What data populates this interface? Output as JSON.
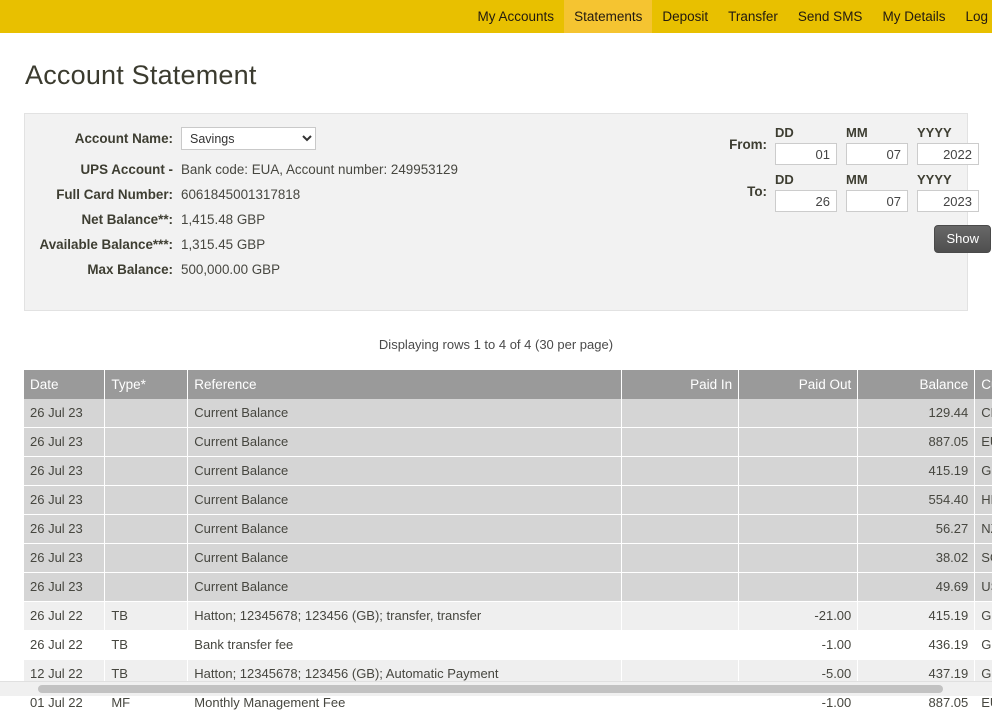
{
  "nav": {
    "items": [
      {
        "label": "My Accounts",
        "active": false
      },
      {
        "label": "Statements",
        "active": true
      },
      {
        "label": "Deposit",
        "active": false
      },
      {
        "label": "Transfer",
        "active": false
      },
      {
        "label": "Send SMS",
        "active": false
      },
      {
        "label": "My Details",
        "active": false
      },
      {
        "label": "Log",
        "active": false
      }
    ],
    "background_color": "#e8c000",
    "active_color": "#f5c431"
  },
  "page": {
    "title": "Account Statement"
  },
  "account_panel": {
    "account_name_label": "Account Name:",
    "account_name_value": "Savings",
    "account_name_options": [
      "Savings"
    ],
    "ups_account_label": "UPS Account -",
    "ups_account_value": "Bank code: EUA, Account number: 249953129",
    "full_card_label": "Full Card Number:",
    "full_card_value": "6061845001317818",
    "net_balance_label": "Net Balance**:",
    "net_balance_value": "1,415.48  GBP",
    "available_balance_label": "Available Balance***:",
    "available_balance_value": "1,315.45 GBP",
    "max_balance_label": "Max Balance:",
    "max_balance_value": "500,000.00  GBP"
  },
  "date_range": {
    "from_label": "From:",
    "to_label": "To:",
    "dd_label": "DD",
    "mm_label": "MM",
    "yyyy_label": "YYYY",
    "from_dd": "01",
    "from_mm": "07",
    "from_yyyy": "2022",
    "to_dd": "26",
    "to_mm": "07",
    "to_yyyy": "2023",
    "show_button": "Show"
  },
  "results": {
    "rows_info": "Displaying rows 1 to 4 of 4 (30 per page)",
    "columns": [
      "Date",
      "Type*",
      "Reference",
      "Paid In",
      "Paid Out",
      "Balance",
      "Currency"
    ],
    "rows": [
      {
        "date": "26 Jul 23",
        "type": "",
        "reference": "Current Balance",
        "paid_in": "",
        "paid_out": "",
        "balance": "129.44",
        "currency": "CHF",
        "style": "bal-row"
      },
      {
        "date": "26 Jul 23",
        "type": "",
        "reference": "Current Balance",
        "paid_in": "",
        "paid_out": "",
        "balance": "887.05",
        "currency": "EUR",
        "style": "bal-row"
      },
      {
        "date": "26 Jul 23",
        "type": "",
        "reference": "Current Balance",
        "paid_in": "",
        "paid_out": "",
        "balance": "415.19",
        "currency": "GBP",
        "style": "bal-row"
      },
      {
        "date": "26 Jul 23",
        "type": "",
        "reference": "Current Balance",
        "paid_in": "",
        "paid_out": "",
        "balance": "554.40",
        "currency": "HKD",
        "style": "bal-row"
      },
      {
        "date": "26 Jul 23",
        "type": "",
        "reference": "Current Balance",
        "paid_in": "",
        "paid_out": "",
        "balance": "56.27",
        "currency": "NZD",
        "style": "bal-row"
      },
      {
        "date": "26 Jul 23",
        "type": "",
        "reference": "Current Balance",
        "paid_in": "",
        "paid_out": "",
        "balance": "38.02",
        "currency": "SGD",
        "style": "bal-row"
      },
      {
        "date": "26 Jul 23",
        "type": "",
        "reference": "Current Balance",
        "paid_in": "",
        "paid_out": "",
        "balance": "49.69",
        "currency": "USD",
        "style": "bal-row"
      },
      {
        "date": "26 Jul 22",
        "type": "TB",
        "reference": "Hatton; 12345678; 123456 (GB); transfer, transfer",
        "paid_in": "",
        "paid_out": "-21.00",
        "balance": "415.19",
        "currency": "GBP",
        "style": "txn-odd"
      },
      {
        "date": "26 Jul 22",
        "type": "TB",
        "reference": "Bank transfer fee",
        "paid_in": "",
        "paid_out": "-1.00",
        "balance": "436.19",
        "currency": "GBP",
        "style": "txn-even"
      },
      {
        "date": "12 Jul 22",
        "type": "TB",
        "reference": "Hatton; 12345678; 123456 (GB); Automatic Payment",
        "paid_in": "",
        "paid_out": "-5.00",
        "balance": "437.19",
        "currency": "GBP",
        "style": "txn-odd"
      },
      {
        "date": "01 Jul 22",
        "type": "MF",
        "reference": "Monthly Management Fee",
        "paid_in": "",
        "paid_out": "-1.00",
        "balance": "887.05",
        "currency": "EUR",
        "style": "txn-even"
      }
    ]
  }
}
